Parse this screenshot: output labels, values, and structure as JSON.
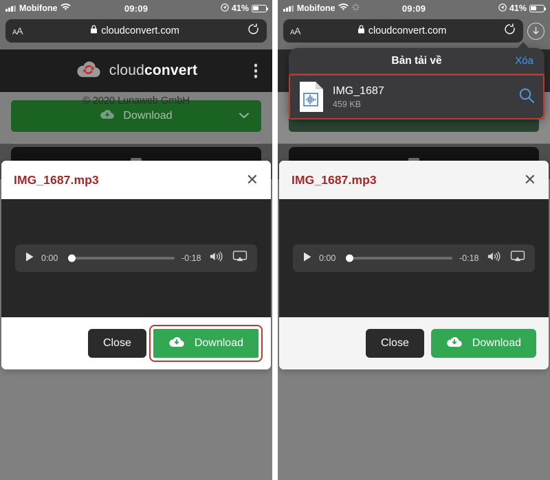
{
  "status_bar": {
    "carrier": "Mobifone",
    "time": "09:09",
    "battery_percent": "41%",
    "signal_icon": "signal-bars-icon",
    "wifi_icon": "wifi-icon",
    "location_icon": "location-arrow-icon",
    "battery_icon": "battery-icon",
    "sync_icon": "sync-spinner-icon"
  },
  "browser": {
    "text_size_label": "AA",
    "lock_icon": "lock-icon",
    "url": "cloudconvert.com",
    "reload_icon": "reload-icon",
    "downloads_icon": "download-arrow-circle-icon"
  },
  "site_header": {
    "logo_icon": "cloudconvert-cloud-logo",
    "brand_light": "cloud",
    "brand_bold": "convert",
    "menu_icon": "kebab-menu-icon"
  },
  "page": {
    "download_button_label": "Download",
    "download_button_icon": "cloud-download-icon",
    "download_chevron_icon": "chevron-down-icon",
    "footer_text": "© 2020 Lunaweb GmbH"
  },
  "modal": {
    "title": "IMG_1687.mp3",
    "close_icon": "close-x-icon",
    "player": {
      "play_icon": "play-triangle-icon",
      "current_time": "0:00",
      "remaining_time": "-0:18",
      "volume_icon": "volume-up-icon",
      "airplay_icon": "airplay-icon",
      "progress_percent": 0
    },
    "close_label": "Close",
    "download_label": "Download",
    "download_icon": "cloud-download-icon"
  },
  "downloads_popover": {
    "title": "Bản tải về",
    "clear_label": "Xóa",
    "file": {
      "icon": "audio-file-document-icon",
      "name": "IMG_1687",
      "size": "459 KB",
      "search_icon": "magnifying-glass-icon"
    }
  },
  "toolbar": {
    "back_icon": "chevron-left-icon",
    "forward_icon": "chevron-right-icon",
    "share_icon": "share-square-up-arrow-icon",
    "bookmarks_icon": "open-book-icon",
    "tabs_icon": "copy-tabs-icon"
  },
  "colors": {
    "brand_green": "#33a852",
    "dimmed_green": "#1b6323",
    "modal_title_red": "#a02a2a",
    "annotation_red": "#c0392b",
    "link_blue": "#3d9bf5"
  }
}
